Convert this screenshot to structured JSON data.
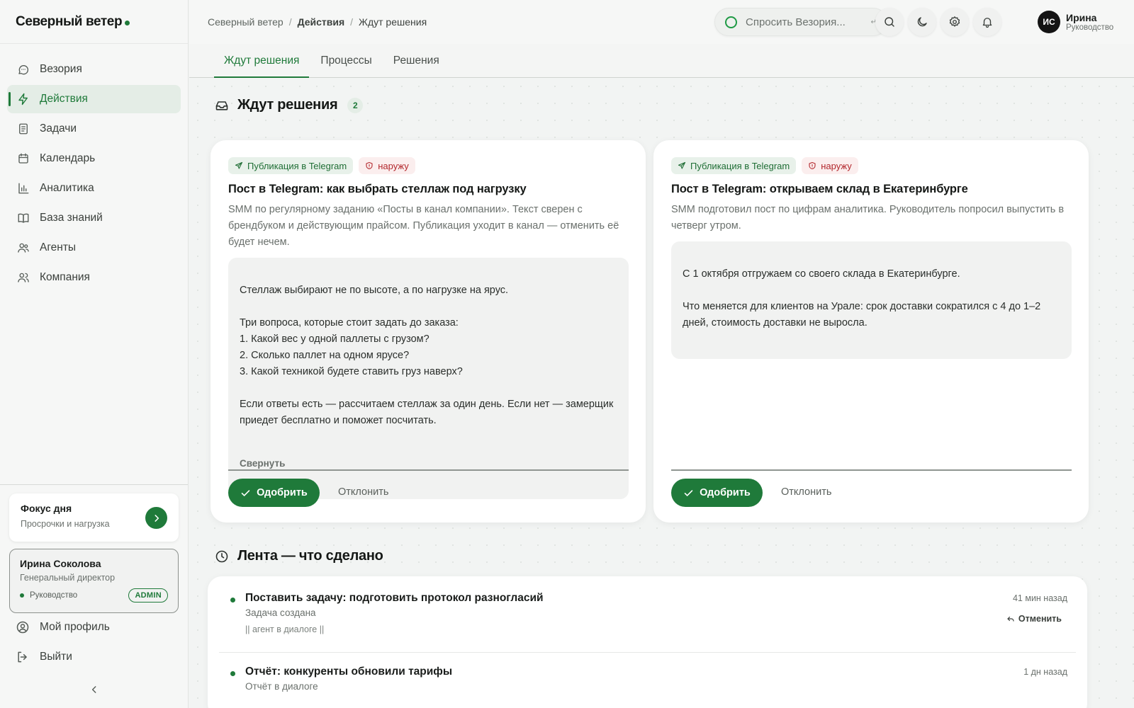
{
  "brand": {
    "name": "Северный ветер"
  },
  "sidebar": {
    "items": [
      {
        "label": "Везория",
        "icon": "chat-icon"
      },
      {
        "label": "Действия",
        "icon": "lightning-icon",
        "active": true
      },
      {
        "label": "Задачи",
        "icon": "tasks-icon"
      },
      {
        "label": "Календарь",
        "icon": "calendar-icon"
      },
      {
        "label": "Аналитика",
        "icon": "analytics-icon"
      },
      {
        "label": "База знаний",
        "icon": "book-icon"
      },
      {
        "label": "Агенты",
        "icon": "agents-icon"
      },
      {
        "label": "Компания",
        "icon": "company-icon"
      }
    ],
    "focus": {
      "title": "Фокус дня",
      "subtitle": "Просрочки и нагрузка"
    },
    "user": {
      "name": "Ирина Соколова",
      "role": "Генеральный директор",
      "department": "Руководство",
      "badge": "ADMIN"
    },
    "profile_label": "Мой профиль",
    "logout_label": "Выйти"
  },
  "header": {
    "breadcrumb": [
      "Северный ветер",
      "Действия",
      "Ждут решения"
    ],
    "ask_placeholder": "Спросить Везория...",
    "ask_hint": "↵",
    "user_initials": "ИС",
    "user_name": "Ирина",
    "user_role": "Руководство"
  },
  "tabs": [
    {
      "label": "Ждут решения",
      "active": true
    },
    {
      "label": "Процессы"
    },
    {
      "label": "Решения"
    }
  ],
  "pending": {
    "title": "Ждут решения",
    "count": "2",
    "cards": [
      {
        "chip_channel": "Публикация в Telegram",
        "chip_scope": "наружу",
        "title": "Пост в Telegram: как выбрать стеллаж под нагрузку",
        "description": "SMM по регулярному заданию «Посты в канал компании». Текст сверен с брендбуком и действующим прайсом. Публикация уходит в канал — отменить её будет нечем.",
        "draft": "Стеллаж выбирают не по высоте, а по нагрузке на ярус.\n\nТри вопроса, которые стоит задать до заказа:\n1. Какой вес у одной паллеты с грузом?\n2. Сколько паллет на одном ярусе?\n3. Какой техникой будете ставить груз наверх?\n\nЕсли ответы есть — рассчитаем стеллаж за один день. Если нет — замерщик приедет бесплатно и поможет посчитать.",
        "draft_toggle": "Свернуть",
        "approve_label": "Одобрить",
        "reject_label": "Отклонить"
      },
      {
        "chip_channel": "Публикация в Telegram",
        "chip_scope": "наружу",
        "title": "Пост в Telegram: открываем склад в Екатеринбурге",
        "description": "SMM подготовил пост по цифрам аналитика. Руководитель попросил выпустить в четверг утром.",
        "draft": "С 1 октября отгружаем со своего склада в Екатеринбурге.\n\nЧто меняется для клиентов на Урале: срок доставки сократился с 4 до 1–2 дней, стоимость доставки не выросла.",
        "approve_label": "Одобрить",
        "reject_label": "Отклонить"
      }
    ]
  },
  "feed": {
    "title": "Лента — что сделано",
    "items": [
      {
        "title": "Поставить задачу: подготовить протокол разногласий",
        "subtitle": "Задача создана",
        "meta": "|| агент в диалоге ||",
        "time": "41 мин назад",
        "action": "Отменить"
      },
      {
        "title": "Отчёт: конкуренты обновили тарифы",
        "subtitle": "Отчёт в диалоге",
        "time": "1 дн назад"
      }
    ]
  },
  "colors": {
    "accent": "#1f7a3a",
    "danger": "#b3282d",
    "background": "#f2f4f3"
  }
}
